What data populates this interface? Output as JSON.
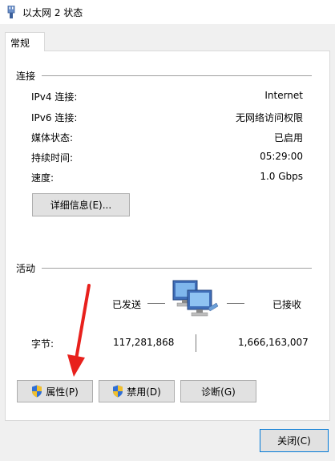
{
  "window": {
    "title": "以太网 2 状态"
  },
  "tabs": [
    {
      "label": "常规"
    }
  ],
  "connection": {
    "section_label": "连接",
    "rows": [
      {
        "label": "IPv4 连接:",
        "value": "Internet"
      },
      {
        "label": "IPv6 连接:",
        "value": "无网络访问权限"
      },
      {
        "label": "媒体状态:",
        "value": "已启用"
      },
      {
        "label": "持续时间:",
        "value": "05:29:00"
      },
      {
        "label": "速度:",
        "value": "1.0 Gbps"
      }
    ],
    "details_button": "详细信息(E)..."
  },
  "activity": {
    "section_label": "活动",
    "sent_label": "已发送",
    "received_label": "已接收",
    "bytes_label": "字节:",
    "bytes_sent": "117,281,868",
    "bytes_received": "1,666,163,007"
  },
  "buttons": {
    "properties": "属性(P)",
    "disable": "禁用(D)",
    "diagnose": "诊断(G)",
    "close": "关闭(C)"
  },
  "colors": {
    "annotation_arrow": "#e8201c",
    "shield_blue": "#2f6fd6",
    "shield_yellow": "#f2c02c",
    "focus_border": "#0078d7"
  },
  "icons": [
    "network-adapter-icon",
    "network-computers-icon",
    "uac-shield-icon"
  ]
}
